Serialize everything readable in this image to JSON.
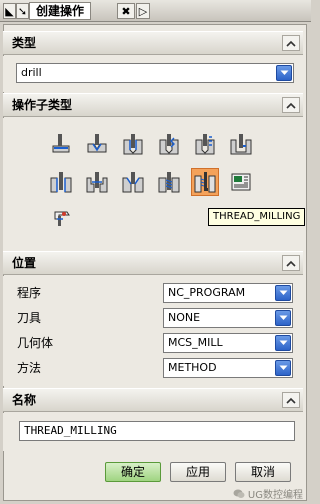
{
  "window": {
    "title": "创建操作",
    "pin_glyph": "◣",
    "arrow_glyph": "➘",
    "close_glyph": "✖",
    "more_glyph": "▷"
  },
  "sections": {
    "type": {
      "header": "类型",
      "value": "drill"
    },
    "subtype": {
      "header": "操作子类型",
      "tooltip": "THREAD_MILLING",
      "icons": [
        "spot-facing-icon",
        "spot-drilling-icon",
        "drilling-icon",
        "peck-drilling-icon",
        "breakchip-drilling-icon",
        "boring-icon",
        "reaming-icon",
        "counterboring-icon",
        "countersinking-icon",
        "tapping-icon",
        "thread-milling-icon",
        "mill-control-icon",
        "mill-user-icon"
      ],
      "selected_index": 10
    },
    "location": {
      "header": "位置",
      "rows": [
        {
          "label": "程序",
          "value": "NC_PROGRAM"
        },
        {
          "label": "刀具",
          "value": "NONE"
        },
        {
          "label": "几何体",
          "value": "MCS_MILL"
        },
        {
          "label": "方法",
          "value": "METHOD"
        }
      ]
    },
    "name": {
      "header": "名称",
      "value": "THREAD_MILLING"
    }
  },
  "buttons": {
    "ok": "确定",
    "apply": "应用",
    "cancel": "取消"
  },
  "watermark": "UG数控编程",
  "colors": {
    "selected_icon": "#f4a25a",
    "ok_button": "#9fd481",
    "combo_arrow": "#2d63c8",
    "tooltip_bg": "#ffffe1"
  }
}
